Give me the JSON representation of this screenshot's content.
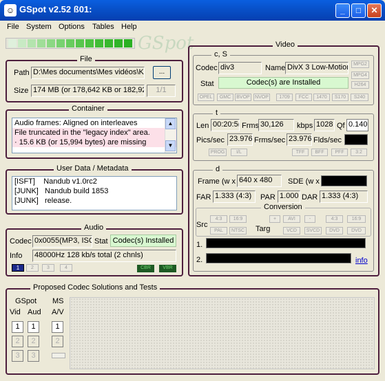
{
  "window": {
    "title": "GSpot v2.52 ß01:"
  },
  "menu": [
    {
      "label": "File",
      "key": "F"
    },
    {
      "label": "System",
      "key": "S"
    },
    {
      "label": "Options",
      "key": "O"
    },
    {
      "label": "Tables",
      "key": "T"
    },
    {
      "label": "Help",
      "key": "H"
    }
  ],
  "logo_text": "GSpot",
  "file": {
    "title": "File",
    "path_label": "Path",
    "path_value": "D:\\Mes documents\\Mes vidéos\\K",
    "browse_label": "...",
    "size_label": "Size",
    "size_value": "174 MB (or 178,642 KB or 182,92",
    "part_label": "1/1"
  },
  "container": {
    "title": "Container",
    "lines": [
      "Audio frames: Aligned on interleaves",
      "File truncated in the \"legacy index\" area.",
      " · 15.6 KB (or 15,994 bytes) are missing"
    ]
  },
  "userdata": {
    "title": "User Data / Metadata",
    "rows": [
      {
        "tag": "[ISFT]",
        "value": "Nandub v1.0rc2"
      },
      {
        "tag": "[JUNK]",
        "value": "Nandub build 1853"
      },
      {
        "tag": "[JUNK]",
        "value": "release."
      }
    ]
  },
  "audio": {
    "title": "Audio",
    "codec_label": "Codec",
    "codec_value": "0x0055(MP3, ISO",
    "stat_label": "Stat",
    "stat_value": "Codec(s) Installed",
    "info_label": "Info",
    "info_value": "48000Hz  128 kb/s total (2 chnls)",
    "streams": [
      "1",
      "2",
      "3",
      "4"
    ],
    "cbr_label": "CBR",
    "vbr_label": "VBR"
  },
  "video": {
    "title": "Video",
    "cs_title": "c, S",
    "codec_label": "Codec",
    "codec_value": "div3",
    "name_label": "Name",
    "name_value": "DivX 3 Low-Motion",
    "stat_label": "Stat",
    "stat_value": "Codec(s) are Installed",
    "right_tags": [
      "MPG2",
      "MPG4",
      "H264"
    ],
    "bottom_tags": [
      "OPEL",
      "GMC",
      "BVOP",
      "NVOP",
      "1709",
      "FCC",
      "1470",
      "S170",
      "S240"
    ],
    "t_title": "t",
    "len_label": "Len",
    "len_value": "00:20:5(",
    "frms_label": "Frms",
    "frms_value": "30,126",
    "kbps_label": "kbps",
    "kbps_value": "1028",
    "qf_label": "Qf",
    "qf_value": "0.140",
    "pics_label": "Pics/sec",
    "pics_value": "23.976",
    "frms_sec_label": "Frms/sec",
    "frms_sec_value": "23.976",
    "flds_label": "Flds/sec",
    "t_tags_left": [
      "PROG",
      "I/L"
    ],
    "t_tags_right": [
      "TFF",
      "BFF",
      "PFF",
      "3:2"
    ],
    "d_title": "d",
    "frame_label": "Frame (w x",
    "frame_value": "640 x 480",
    "sde_label": "SDE (w x",
    "far_label": "FAR",
    "far_value": "1.333 (4:3)",
    "par_label": "PAR",
    "par_value": "1.000",
    "dar_label": "DAR",
    "dar_value": "1.333 (4:3)",
    "conversion_title": "Conversion",
    "src_label": "Src",
    "targ_label": "Targ",
    "src_tags": [
      "4:3",
      "16:9",
      "PAL",
      "NTSC"
    ],
    "targ_tags": [
      "+",
      "AVI",
      "-",
      "4:3",
      "16:9",
      "VCD",
      "SVCD",
      "DVD",
      "DVD"
    ],
    "line1_label": "1.",
    "line2_label": "2.",
    "info_link": "info"
  },
  "codec_solutions": {
    "title": "Proposed Codec Solutions and Tests",
    "gspot_label": "GSpot",
    "ms_label": "MS",
    "vid_label": "Vid",
    "aud_label": "Aud",
    "av_label": "A/V",
    "buttons": [
      "1",
      "2",
      "3"
    ]
  }
}
